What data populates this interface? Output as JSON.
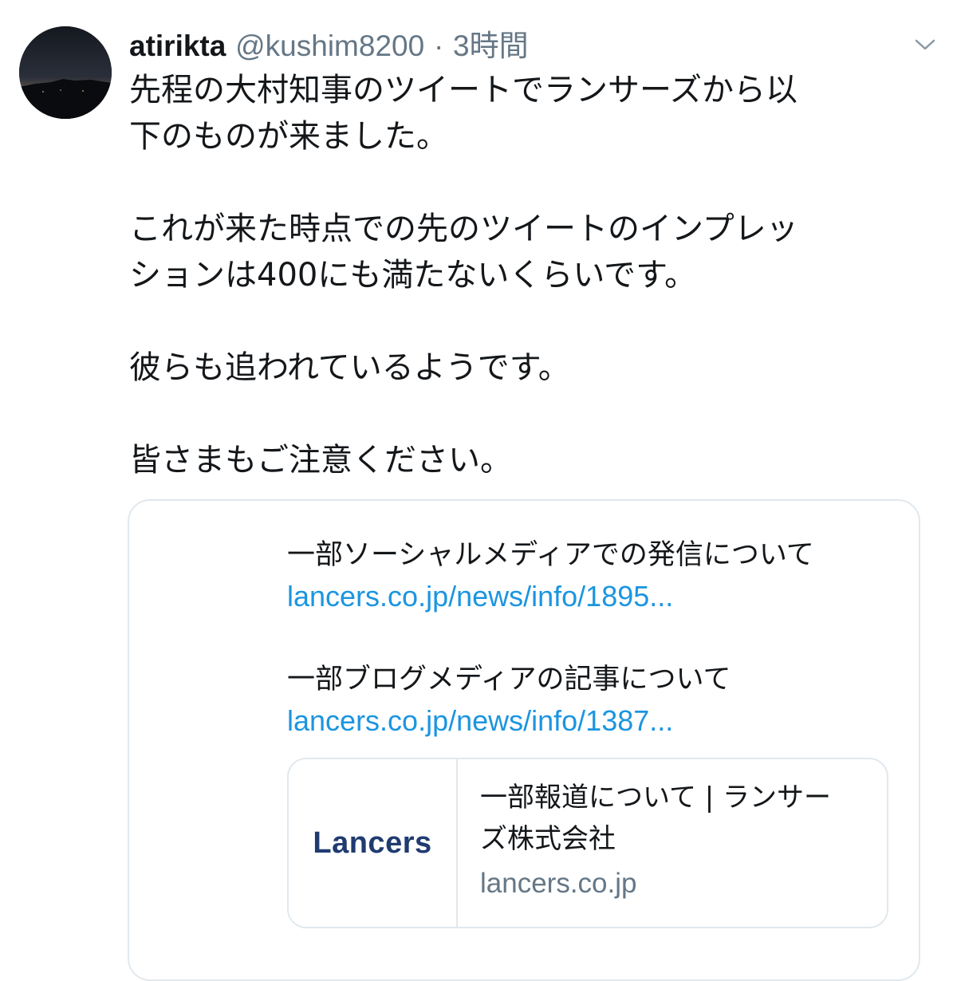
{
  "tweet": {
    "author_name": "atirikta",
    "author_handle": "@kushim8200",
    "separator": "·",
    "timestamp": "3時間",
    "avatar_icon": "avatar-night-landscape",
    "menu_icon": "chevron-down-icon",
    "text_lines": [
      "先程の大村知事のツイートでランサーズから以",
      "下のものが来ました。",
      "これが来た時点での先のツイートのインプレッ",
      "ションは400にも満たないくらいです。",
      "彼らも追われているようです。",
      "皆さまもご注意ください。"
    ]
  },
  "quoted": {
    "item1_title": "一部ソーシャルメディアでの発信について",
    "item1_link": "lancers.co.jp/news/info/1895...",
    "item2_title": "一部ブログメディアの記事について",
    "item2_link": "lancers.co.jp/news/info/1387...",
    "card": {
      "logo_text": "Lancers",
      "title_line1": "一部報道について | ランサー",
      "title_line2": "ズ株式会社",
      "domain": "lancers.co.jp"
    }
  },
  "colors": {
    "link": "#1b95e0",
    "secondary_text": "#657786",
    "border": "#e1e8ed",
    "brand": "#1f3b70"
  }
}
